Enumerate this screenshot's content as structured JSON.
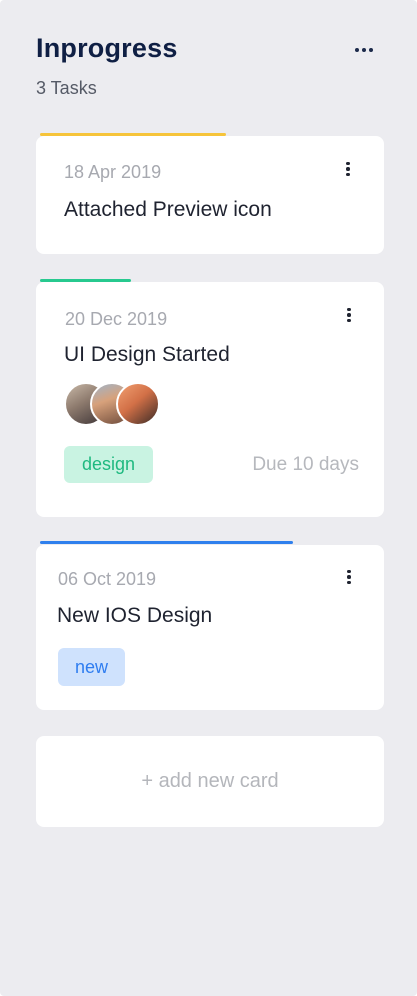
{
  "column": {
    "title": "Inprogress",
    "task_count": "3 Tasks",
    "menu_icon": "more-horizontal-icon"
  },
  "cards": [
    {
      "date": "18 Apr 2019",
      "title": "Attached Preview icon",
      "accent_color": "#f6c43a",
      "menu_icon": "more-vertical-icon"
    },
    {
      "date": "20 Dec 2019",
      "title": "UI Design Started",
      "accent_color": "#27c98f",
      "menu_icon": "more-vertical-icon",
      "avatars": [
        "avatar-1",
        "avatar-2",
        "avatar-3"
      ],
      "tag": {
        "label": "design",
        "bg": "#c9f3e2",
        "color": "#1fb980"
      },
      "due": "Due 10 days"
    },
    {
      "date": "06 Oct 2019",
      "title": "New IOS Design",
      "accent_color": "#2f80ed",
      "menu_icon": "more-vertical-icon",
      "tag": {
        "label": "new",
        "bg": "#cfe2fd",
        "color": "#2f7df0"
      }
    }
  ],
  "add_card_label": "+ add new card"
}
